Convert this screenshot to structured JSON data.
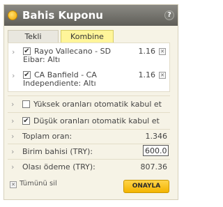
{
  "header": {
    "title": "Bahis Kuponu",
    "help_label": "?"
  },
  "tabs": [
    {
      "label": "Tekli"
    },
    {
      "label": "Kombine"
    }
  ],
  "bets": [
    {
      "match": "Rayo Vallecano - SD Eibar: Altı",
      "match_line1": "Rayo Vallecano - SD",
      "match_line2": "Eibar: Altı",
      "odds": "1.16",
      "checked": true
    },
    {
      "match": "CA Banfield - CA Independiente: Altı",
      "match_line1": "CA Banfield - CA",
      "match_line2": "Independiente: Altı",
      "odds": "1.16",
      "checked": true
    }
  ],
  "options": [
    {
      "label": "Yüksek oranları otomatik kabul et",
      "checked": false
    },
    {
      "label": "Düşük oranları otomatik kabul et",
      "checked": true
    }
  ],
  "summary": {
    "total_odds_label": "Toplam oran:",
    "total_odds_value": "1.346",
    "stake_label": "Birim bahisi (TRY):",
    "stake_value": "600.00",
    "payout_label": "Olası ödeme (TRY):",
    "payout_value": "807.36"
  },
  "footer": {
    "delete_all": "Tümünü sil",
    "confirm": "ONAYLA"
  },
  "colors": {
    "header": "#6e6d67",
    "accent": "#f6c21c",
    "panel_bg": "#f6f3e6"
  },
  "icons": [
    "coin-icon",
    "help-icon",
    "chevron-right-icon",
    "checkbox-icon",
    "remove-icon"
  ]
}
